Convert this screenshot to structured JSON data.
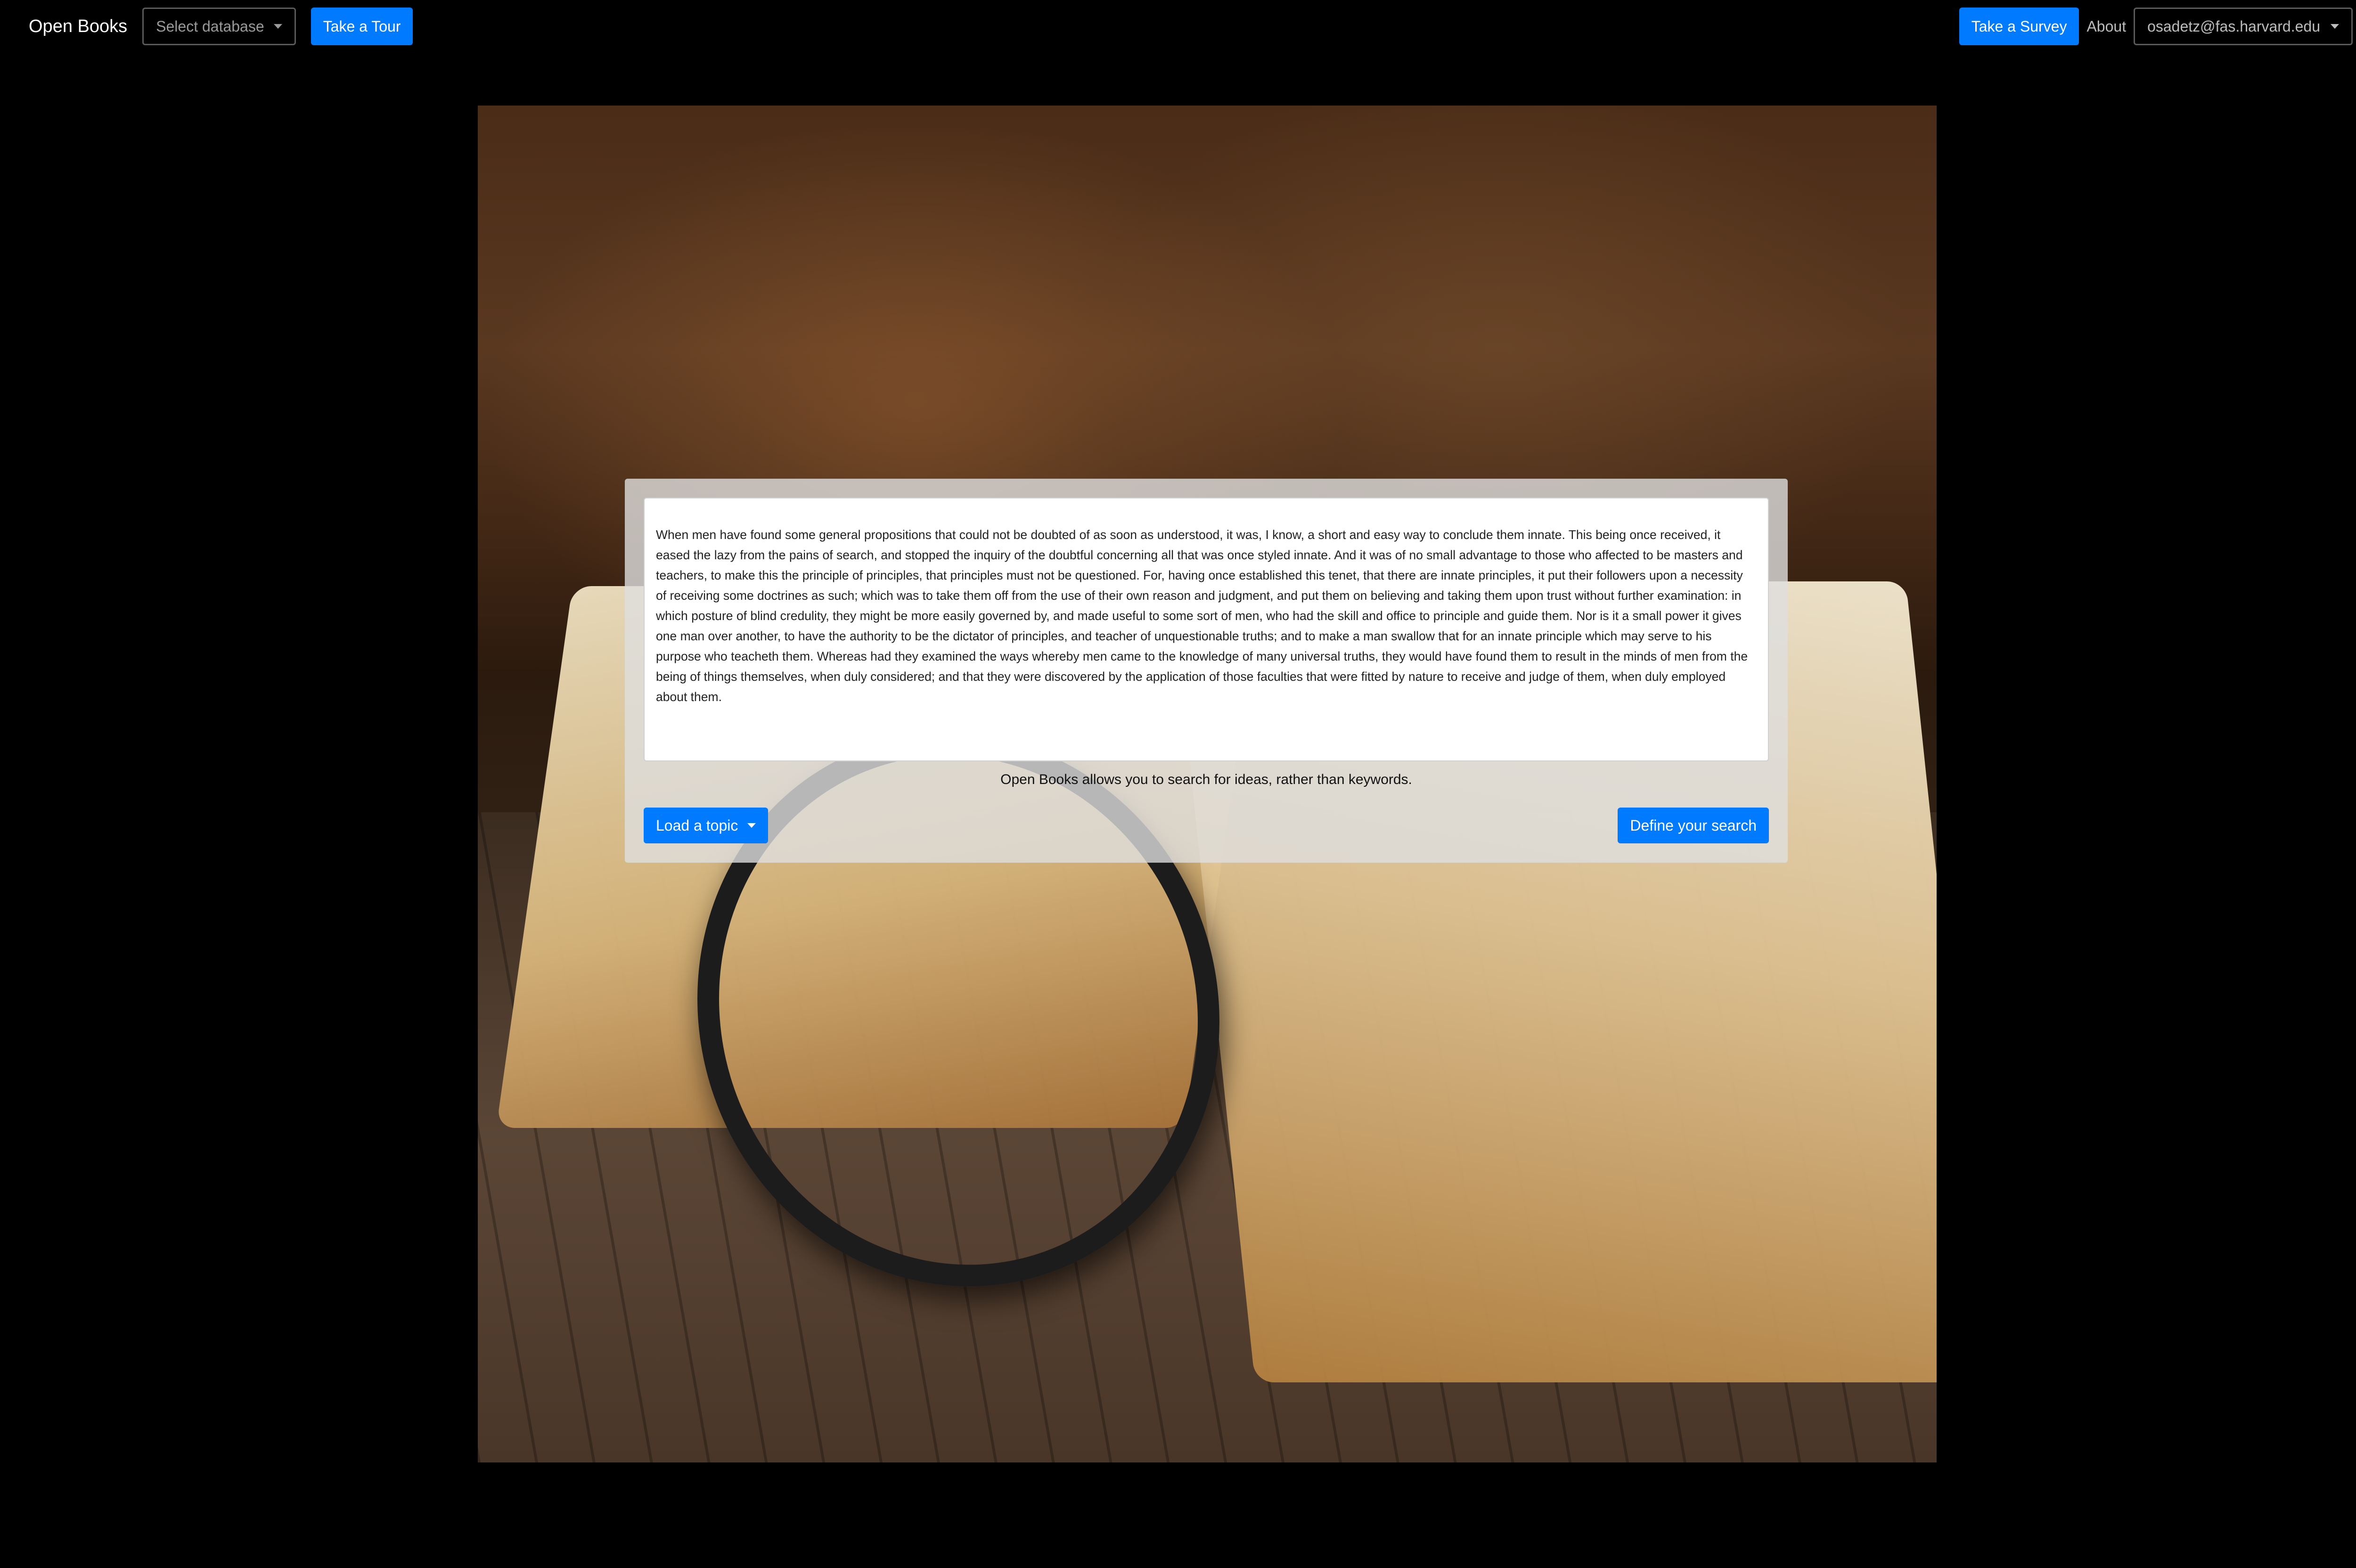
{
  "navbar": {
    "brand": "Open Books",
    "database_select": {
      "placeholder": "Select database"
    },
    "tour_button": "Take a Tour",
    "survey_button": "Take a Survey",
    "about_link": "About",
    "user_email": "osadetz@fas.harvard.edu"
  },
  "search_panel": {
    "passage": "When men have found some general propositions that could not be doubted of as soon as understood, it was, I know, a short and easy way to conclude them innate. This being once received, it eased the lazy from the pains of search, and stopped the inquiry of the doubtful concerning all that was once styled innate. And it was of no small advantage to those who affected to be masters and teachers, to make this the principle of principles, that principles must not be questioned. For, having once established this tenet, that there are innate principles, it put their followers upon a necessity of receiving some doctrines as such; which was to take them off from the use of their own reason and judgment, and put them on believing and taking them upon trust without further examination: in which posture of blind credulity, they might be more easily governed by, and made useful to some sort of men, who had the skill and office to principle and guide them. Nor is it a small power it gives one man over another, to have the authority to be the dictator of principles, and teacher of unquestionable truths; and to make a man swallow that for an innate principle which may serve to his purpose who teacheth them. Whereas had they examined the ways whereby men came to the knowledge of many universal truths, they would have found them to result in the minds of men from the being of things themselves, when duly considered; and that they were discovered by the application of those faculties that were fitted by nature to receive and judge of them, when duly employed about them.",
    "tagline": "Open Books allows you to search for ideas, rather than keywords.",
    "load_topic_button": "Load a topic",
    "define_search_button": "Define your search"
  },
  "colors": {
    "accent": "#007bff",
    "background": "#000000"
  }
}
